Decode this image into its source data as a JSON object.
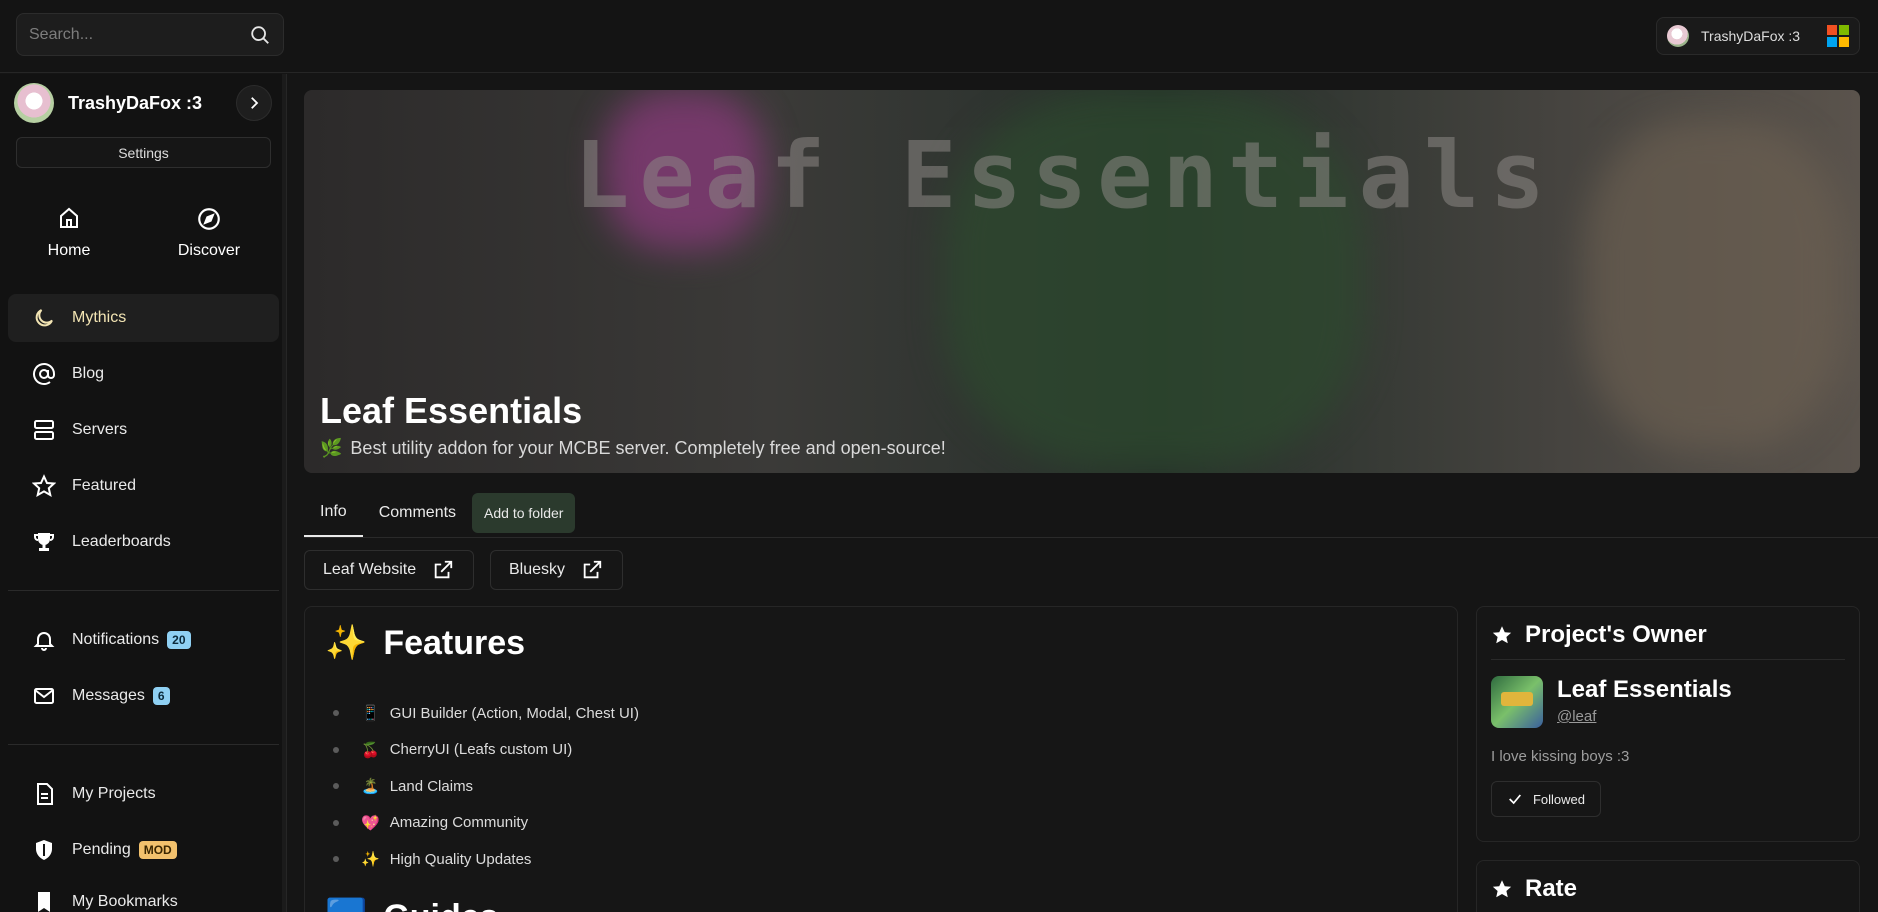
{
  "search": {
    "placeholder": "Search..."
  },
  "account": {
    "name": "TrashyDaFox :3"
  },
  "sidebar": {
    "user_name": "TrashyDaFox :3",
    "settings_label": "Settings",
    "quick": [
      {
        "label": "Home",
        "icon": "home-icon"
      },
      {
        "label": "Discover",
        "icon": "compass-icon"
      }
    ],
    "items": [
      {
        "label": "Mythics",
        "icon": "moon-icon",
        "active": true
      },
      {
        "label": "Blog",
        "icon": "at-icon"
      },
      {
        "label": "Servers",
        "icon": "server-icon"
      },
      {
        "label": "Featured",
        "icon": "star-icon"
      },
      {
        "label": "Leaderboards",
        "icon": "trophy-icon"
      }
    ],
    "notifications": {
      "label": "Notifications",
      "count": "20"
    },
    "messages": {
      "label": "Messages",
      "count": "6"
    },
    "my_projects": "My Projects",
    "pending": {
      "label": "Pending",
      "badge": "MOD"
    },
    "bookmarks": "My Bookmarks"
  },
  "project": {
    "title": "Leaf Essentials",
    "subtitle_icon": "🌿",
    "subtitle": "Best utility addon for your MCBE server. Completely free and open-source!",
    "banner_text": "Leaf Essentials"
  },
  "tabs": {
    "info": "Info",
    "comments": "Comments",
    "add_to_folder": "Add to folder"
  },
  "links": [
    {
      "label": "Leaf Website"
    },
    {
      "label": "Bluesky"
    }
  ],
  "features": {
    "heading_icon": "✨",
    "heading": "Features",
    "items": [
      {
        "emoji": "📱",
        "text": "GUI Builder (Action, Modal, Chest UI)"
      },
      {
        "emoji": "🍒",
        "text": "CherryUI (Leafs custom UI)"
      },
      {
        "emoji": "🏝️",
        "text": "Land Claims"
      },
      {
        "emoji": "💖",
        "text": "Amazing Community"
      },
      {
        "emoji": "✨",
        "text": "High Quality Updates"
      }
    ],
    "next_heading_icon": "🟦",
    "next_heading": "Guides"
  },
  "owner": {
    "heading": "Project's Owner",
    "name": "Leaf Essentials",
    "handle": "@leaf",
    "bio": "I love kissing boys :3",
    "follow_label": "Followed"
  },
  "rate": {
    "heading": "Rate"
  },
  "colors": {
    "accent_green": "#2b3a2d",
    "badge_blue": "#8fd0f3",
    "badge_mod": "#f2c16d",
    "active_text": "#f2e4b3"
  }
}
